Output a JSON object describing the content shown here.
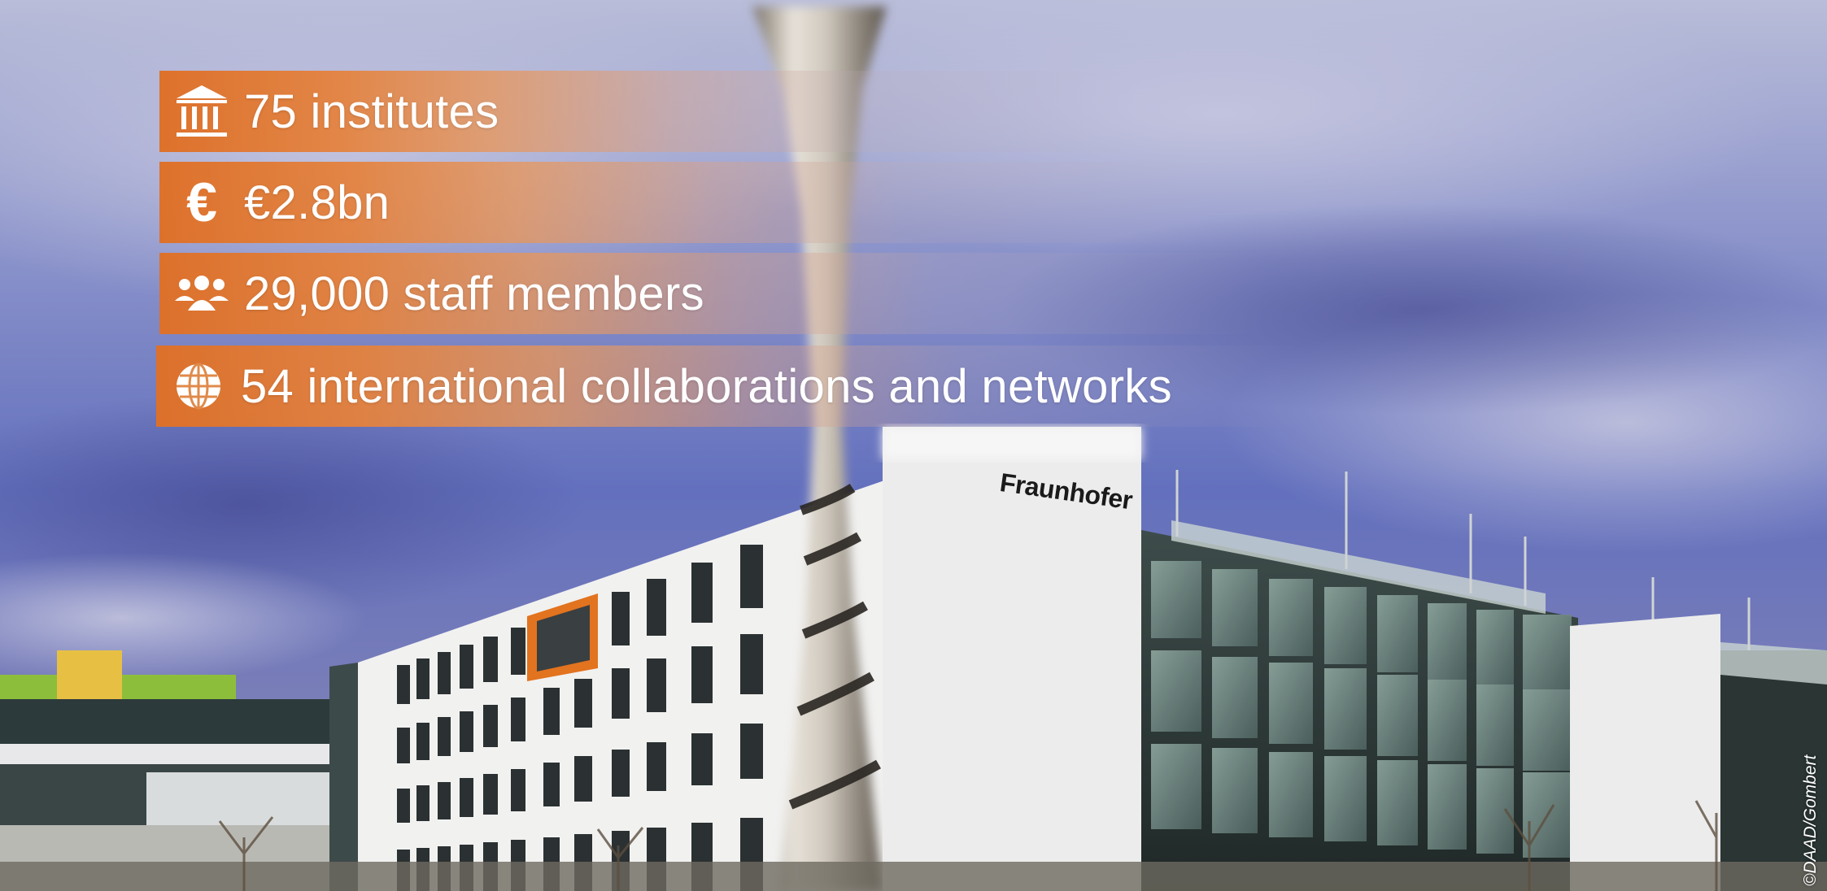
{
  "stats": [
    {
      "icon": "institution-icon",
      "label": "75 institutes"
    },
    {
      "icon": "euro-icon",
      "label": "€2.8bn"
    },
    {
      "icon": "people-icon",
      "label": "29,000 staff members"
    },
    {
      "icon": "globe-icon",
      "label": "54 international collaborations and networks"
    }
  ],
  "building_sign": "Fraunhofer",
  "photo_credit": "©DAAD/Gombert",
  "colors": {
    "accent_orange": "#E07A30",
    "sky_blue": "#5A6BB8",
    "facade_white": "#F2F2F2",
    "glass_dark": "#2C3A3A"
  }
}
